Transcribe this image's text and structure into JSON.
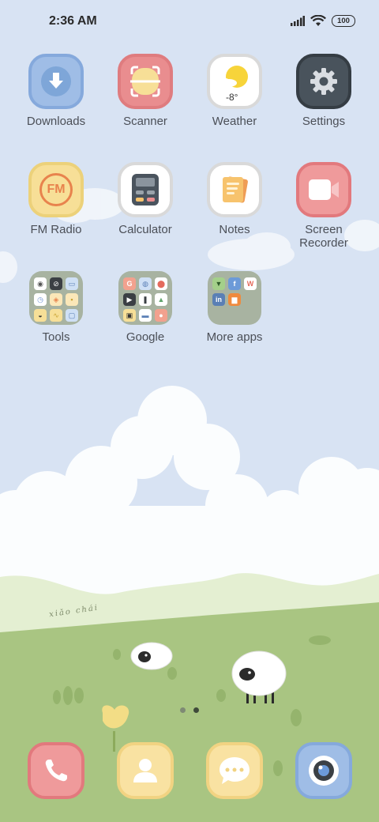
{
  "status_bar": {
    "time": "2:36 AM",
    "battery": "100"
  },
  "apps": [
    {
      "id": "downloads",
      "label": "Downloads",
      "icon": "download-icon"
    },
    {
      "id": "scanner",
      "label": "Scanner",
      "icon": "scanner-icon"
    },
    {
      "id": "weather",
      "label": "Weather",
      "icon": "weather-icon",
      "temp": "-8°"
    },
    {
      "id": "settings",
      "label": "Settings",
      "icon": "gear-icon"
    },
    {
      "id": "fm-radio",
      "label": "FM Radio",
      "icon": "fm-radio-icon",
      "icon_text": "FM"
    },
    {
      "id": "calculator",
      "label": "Calculator",
      "icon": "calculator-icon"
    },
    {
      "id": "notes",
      "label": "Notes",
      "icon": "notes-icon"
    },
    {
      "id": "screen-recorder",
      "label": "Screen\nRecorder",
      "icon": "video-camera-icon"
    }
  ],
  "folders": [
    {
      "id": "tools",
      "label": "Tools"
    },
    {
      "id": "google",
      "label": "Google"
    },
    {
      "id": "more-apps",
      "label": "More apps"
    }
  ],
  "wallpaper": {
    "signature": "xiǎo chái"
  },
  "page_indicator": {
    "count": 2,
    "active": 2
  },
  "dock": [
    {
      "id": "phone",
      "icon": "phone-icon"
    },
    {
      "id": "contacts",
      "icon": "contacts-icon"
    },
    {
      "id": "messages",
      "icon": "message-icon"
    },
    {
      "id": "camera",
      "icon": "camera-icon"
    }
  ],
  "colors": {
    "sky": "#d8e3f3",
    "grass": "#a9c582",
    "blue_tile": "#9fbde6",
    "pink_tile": "#e98d8f",
    "yellow_tile": "#f7df97",
    "dark_tile": "#49535c",
    "folder": "#a8b3a1"
  }
}
